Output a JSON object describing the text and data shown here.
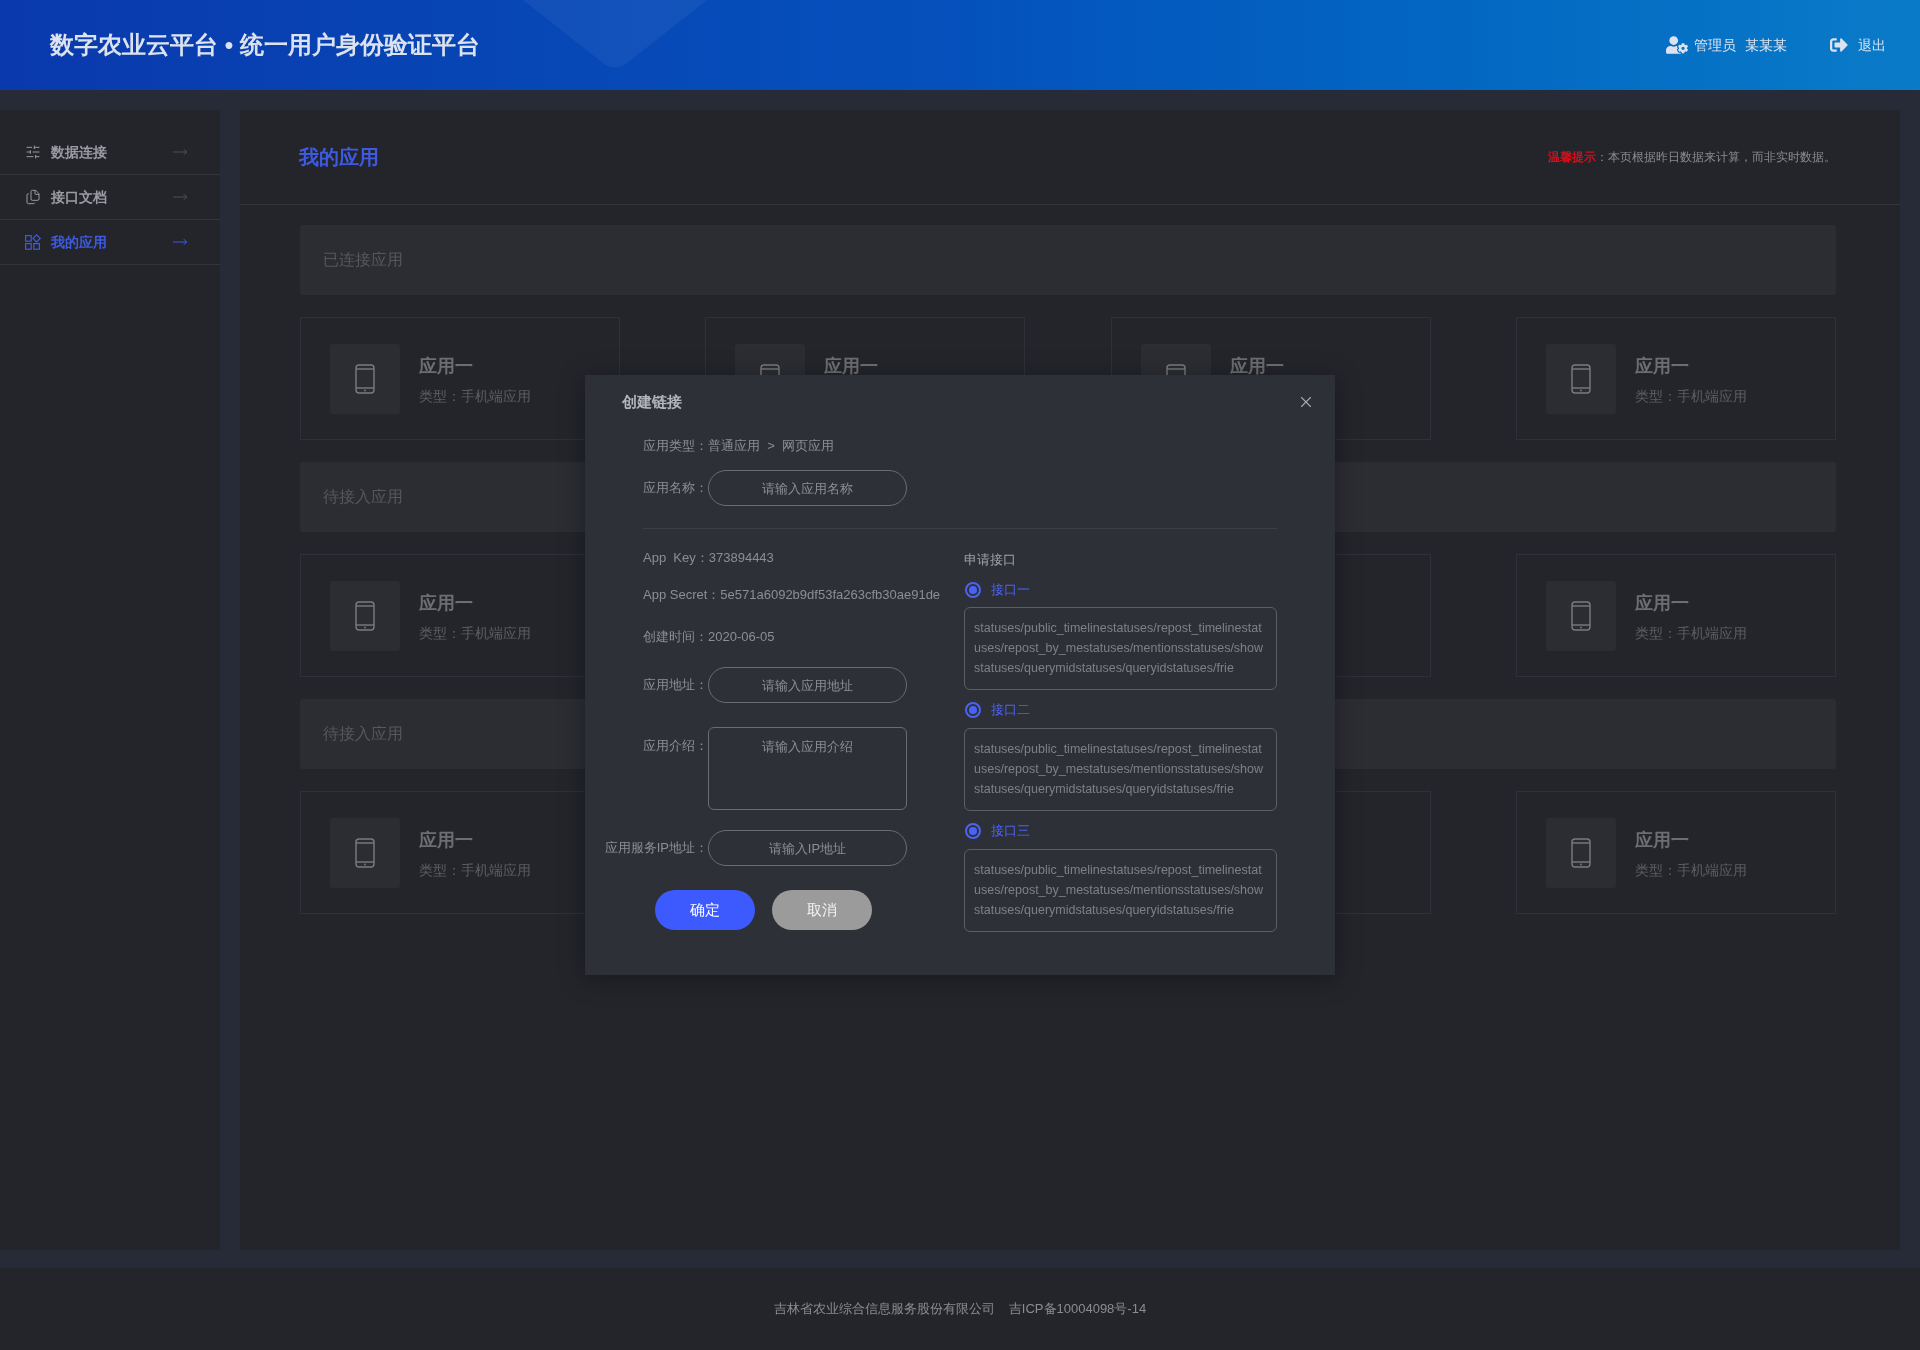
{
  "header": {
    "title": "数字农业云平台 • 统一用户身份验证平台",
    "user": {
      "role": "管理员",
      "name": "某某某"
    },
    "logout": "退出"
  },
  "sidebar": {
    "items": [
      {
        "label": "数据连接",
        "selected": false
      },
      {
        "label": "接口文档",
        "selected": false
      },
      {
        "label": "我的应用",
        "selected": true
      }
    ]
  },
  "page": {
    "title": "我的应用",
    "notice": {
      "label": "温馨提示",
      "text": "：本页根据昨日数据来计算，而非实时数据。"
    }
  },
  "sections": [
    {
      "title": "已连接应用",
      "cards": [
        {
          "kind": "app",
          "title": "应用一",
          "subtitle": "类型：手机端应用"
        },
        {
          "kind": "app",
          "title": "应用一"
        },
        {
          "kind": "app",
          "title": "应用一"
        },
        {
          "kind": "app",
          "title": "应用一",
          "subtitle": "类型：手机端应用"
        }
      ]
    },
    {
      "title": "待接入应用",
      "cards": [
        {
          "kind": "clipped",
          "title": "应用一",
          "subtitle": "类型：手机端应用"
        },
        {
          "kind": "covered"
        },
        {
          "kind": "frame"
        },
        {
          "kind": "app",
          "title": "应用一",
          "subtitle": "类型：手机端应用"
        }
      ]
    },
    {
      "title": "待接入应用",
      "cards": [
        {
          "kind": "clipped",
          "title": "应用一",
          "subtitle": "类型：手机端应用"
        },
        {
          "kind": "covered"
        },
        {
          "kind": "frame"
        },
        {
          "kind": "app",
          "title": "应用一",
          "subtitle": "类型：手机端应用"
        }
      ]
    }
  ],
  "dialog": {
    "title": "创建链接",
    "breadcrumb": "应用类型：普通应用  >  网页应用",
    "name_field": {
      "label": "应用名称：",
      "placeholder": "请输入应用名称"
    },
    "info": [
      "App  Key：373894443",
      "App Secret：5e571a6092b9df53fa263cfb30ae91de",
      "创建时间：2020-06-05"
    ],
    "fields": [
      {
        "kind": "input",
        "label": "应用地址：",
        "placeholder": "请输入应用地址"
      },
      {
        "kind": "textarea",
        "label": "应用介绍：",
        "placeholder": "请输入应用介绍"
      },
      {
        "kind": "input",
        "label": "应用服务IP地址：",
        "placeholder": "请输入IP地址"
      }
    ],
    "buttons": [
      {
        "kind": "primary",
        "label": "确定"
      },
      {
        "kind": "secondary",
        "label": "取消"
      }
    ],
    "interfaces": {
      "title": "申请接口",
      "items": [
        {
          "label": "接口一",
          "checked": true,
          "value": "statuses/public_timelinestatuses/repost_timelinestatuses/repost_by_mestatuses/mentionsstatuses/showstatuses/querymidstatuses/queryidstatuses/frie"
        },
        {
          "label": "接口二",
          "checked": true,
          "value": "statuses/public_timelinestatuses/repost_timelinestatuses/repost_by_mestatuses/mentionsstatuses/showstatuses/querymidstatuses/queryidstatuses/frie"
        },
        {
          "label": "接口三",
          "checked": true,
          "value": "statuses/public_timelinestatuses/repost_timelinestatuses/repost_by_mestatuses/mentionsstatuses/showstatuses/querymidstatuses/queryidstatuses/frie"
        }
      ]
    }
  },
  "footer": {
    "company": "吉林省农业综合信息服务股份有限公司",
    "icp": "吉ICP备10004098号-14"
  }
}
